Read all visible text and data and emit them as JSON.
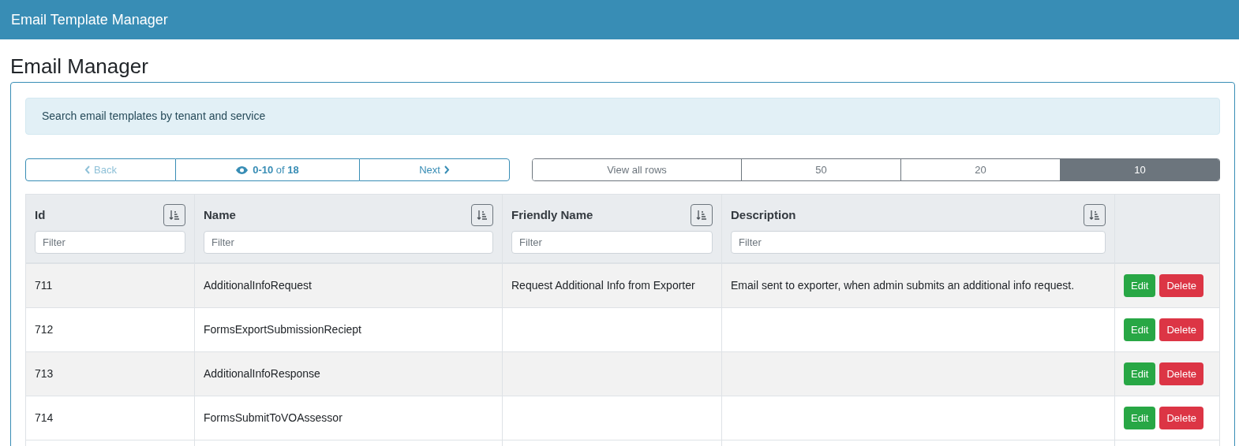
{
  "app_bar": {
    "title": "Email Template Manager"
  },
  "page_title": "Email Manager",
  "info": "Search email templates by tenant and service",
  "pager": {
    "back": {
      "label": "Back",
      "disabled": true
    },
    "range": "0-10",
    "of": "of",
    "total": "18",
    "next": {
      "label": "Next",
      "disabled": false
    }
  },
  "page_sizes": [
    {
      "label": "View all rows",
      "selected": false
    },
    {
      "label": "50",
      "selected": false
    },
    {
      "label": "20",
      "selected": false
    },
    {
      "label": "10",
      "selected": true
    }
  ],
  "table": {
    "columns": [
      {
        "label": "Id",
        "filter_placeholder": "Filter"
      },
      {
        "label": "Name",
        "filter_placeholder": "Filter"
      },
      {
        "label": "Friendly Name",
        "filter_placeholder": "Filter"
      },
      {
        "label": "Description",
        "filter_placeholder": "Filter"
      }
    ],
    "rows": [
      {
        "cells": [
          "711",
          "AdditionalInfoRequest",
          "Request Additional Info from Exporter",
          "Email sent to exporter, when admin submits an additional info request."
        ],
        "actions": [
          "Edit",
          "Delete"
        ]
      },
      {
        "cells": [
          "712",
          "FormsExportSubmissionReciept",
          "",
          ""
        ],
        "actions": [
          "Edit",
          "Delete"
        ]
      },
      {
        "cells": [
          "713",
          "AdditionalInfoResponse",
          "",
          ""
        ],
        "actions": [
          "Edit",
          "Delete"
        ]
      },
      {
        "cells": [
          "714",
          "FormsSubmitToVOAssessor",
          "",
          ""
        ],
        "actions": [
          "Edit",
          "Delete"
        ]
      }
    ]
  }
}
